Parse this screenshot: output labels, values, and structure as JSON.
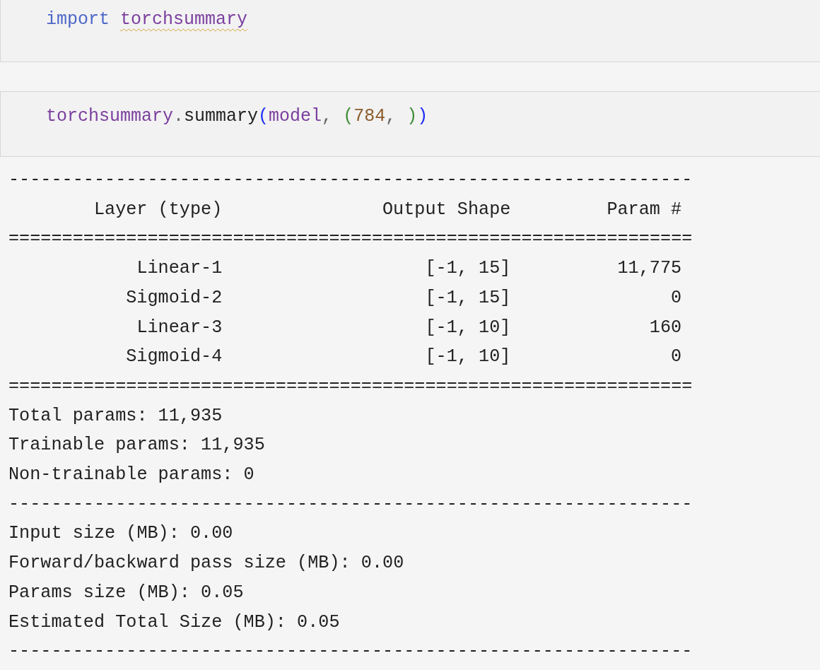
{
  "cells": [
    {
      "tokens": [
        {
          "text": "import ",
          "kind": "keyword",
          "warning": false
        },
        {
          "text": "torchsummary",
          "kind": "module",
          "warning": true
        }
      ]
    },
    {
      "tokens": [
        {
          "text": "torchsummary",
          "kind": "module",
          "warning": false
        },
        {
          "text": ".",
          "kind": "punct",
          "warning": false
        },
        {
          "text": "summary",
          "kind": "plain",
          "warning": false
        },
        {
          "text": "(",
          "kind": "bracket1",
          "warning": false
        },
        {
          "text": "model",
          "kind": "module",
          "warning": false
        },
        {
          "text": ", ",
          "kind": "punct",
          "warning": false
        },
        {
          "text": "(",
          "kind": "bracket2",
          "warning": false
        },
        {
          "text": "784",
          "kind": "number",
          "warning": false
        },
        {
          "text": ", ",
          "kind": "punct",
          "warning": false
        },
        {
          "text": ")",
          "kind": "bracket2",
          "warning": false
        },
        {
          "text": ")",
          "kind": "bracket1",
          "warning": false
        }
      ]
    }
  ],
  "output": [
    {
      "kind": "rule",
      "text": "----------------------------------------------------------------"
    },
    {
      "kind": "header",
      "cells": [
        "Layer (type)",
        "Output Shape",
        "Param #"
      ]
    },
    {
      "kind": "rule",
      "text": "================================================================"
    },
    {
      "kind": "row",
      "cells": [
        "Linear-1",
        "[-1, 15]",
        "11,775"
      ]
    },
    {
      "kind": "row",
      "cells": [
        "Sigmoid-2",
        "[-1, 15]",
        "0"
      ]
    },
    {
      "kind": "row",
      "cells": [
        "Linear-3",
        "[-1, 10]",
        "160"
      ]
    },
    {
      "kind": "row",
      "cells": [
        "Sigmoid-4",
        "[-1, 10]",
        "0"
      ]
    },
    {
      "kind": "rule",
      "text": "================================================================"
    },
    {
      "kind": "line",
      "text": "Total params: 11,935"
    },
    {
      "kind": "line",
      "text": "Trainable params: 11,935"
    },
    {
      "kind": "line",
      "text": "Non-trainable params: 0"
    },
    {
      "kind": "rule",
      "text": "----------------------------------------------------------------"
    },
    {
      "kind": "line",
      "text": "Input size (MB): 0.00"
    },
    {
      "kind": "line",
      "text": "Forward/backward pass size (MB): 0.00"
    },
    {
      "kind": "line",
      "text": "Params size (MB): 0.05"
    },
    {
      "kind": "line",
      "text": "Estimated Total Size (MB): 0.05"
    },
    {
      "kind": "rule",
      "text": "----------------------------------------------------------------"
    }
  ]
}
